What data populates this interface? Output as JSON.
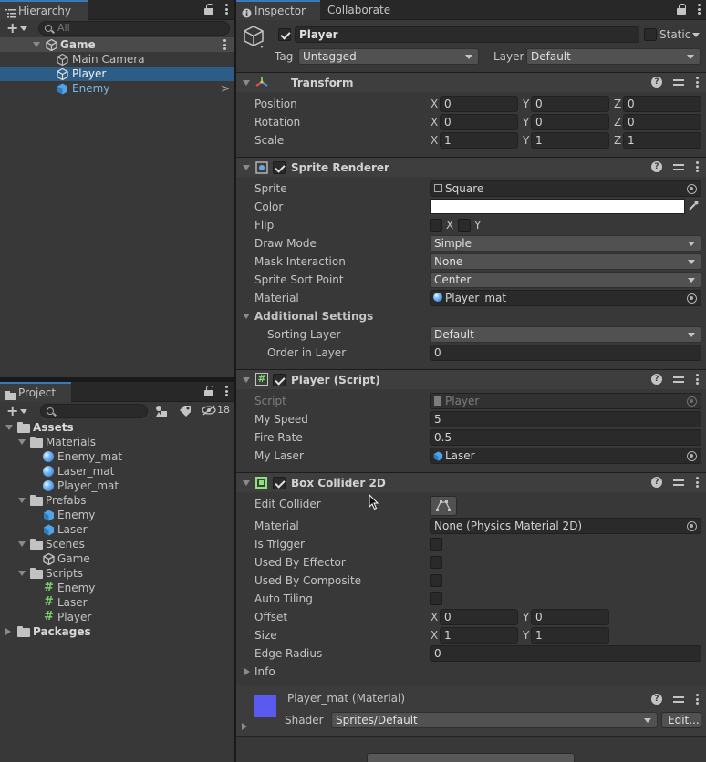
{
  "hierarchy": {
    "tab_label": "Hierarchy",
    "search_placeholder": "All",
    "scene": "Game",
    "items": [
      {
        "label": "Main Camera"
      },
      {
        "label": "Player"
      },
      {
        "label": "Enemy"
      }
    ]
  },
  "project": {
    "tab_label": "Project",
    "hidden_count": "18",
    "tree": [
      {
        "label": "Assets"
      },
      {
        "label": "Materials"
      },
      {
        "label": "Enemy_mat"
      },
      {
        "label": "Laser_mat"
      },
      {
        "label": "Player_mat"
      },
      {
        "label": "Prefabs"
      },
      {
        "label": "Enemy"
      },
      {
        "label": "Laser"
      },
      {
        "label": "Scenes"
      },
      {
        "label": "Game"
      },
      {
        "label": "Scripts"
      },
      {
        "label": "Enemy"
      },
      {
        "label": "Laser"
      },
      {
        "label": "Player"
      },
      {
        "label": "Packages"
      }
    ]
  },
  "inspector": {
    "tab_label": "Inspector",
    "tab2_label": "Collaborate",
    "object_name": "Player",
    "static_label": "Static",
    "tag_label": "Tag",
    "tag_value": "Untagged",
    "layer_label": "Layer",
    "layer_value": "Default",
    "transform": {
      "title": "Transform",
      "position_label": "Position",
      "rotation_label": "Rotation",
      "scale_label": "Scale",
      "position": {
        "x": "0",
        "y": "0",
        "z": "0"
      },
      "rotation": {
        "x": "0",
        "y": "0",
        "z": "0"
      },
      "scale": {
        "x": "1",
        "y": "1",
        "z": "1"
      }
    },
    "sprite_renderer": {
      "title": "Sprite Renderer",
      "sprite_label": "Sprite",
      "sprite_value": "Square",
      "color_label": "Color",
      "color_value": "#ffffff",
      "flip_label": "Flip",
      "flip_x": "X",
      "flip_y": "Y",
      "draw_mode_label": "Draw Mode",
      "draw_mode_value": "Simple",
      "mask_label": "Mask Interaction",
      "mask_value": "None",
      "sort_point_label": "Sprite Sort Point",
      "sort_point_value": "Center",
      "material_label": "Material",
      "material_value": "Player_mat",
      "additional_label": "Additional Settings",
      "sorting_layer_label": "Sorting Layer",
      "sorting_layer_value": "Default",
      "order_label": "Order in Layer",
      "order_value": "0"
    },
    "player_script": {
      "title": "Player (Script)",
      "script_label": "Script",
      "script_value": "Player",
      "speed_label": "My Speed",
      "speed_value": "5",
      "fire_label": "Fire Rate",
      "fire_value": "0.5",
      "laser_label": "My Laser",
      "laser_value": "Laser"
    },
    "box_collider": {
      "title": "Box Collider 2D",
      "edit_label": "Edit Collider",
      "material_label": "Material",
      "material_value": "None (Physics Material 2D)",
      "trigger_label": "Is Trigger",
      "effector_label": "Used By Effector",
      "composite_label": "Used By Composite",
      "tiling_label": "Auto Tiling",
      "offset_label": "Offset",
      "offset": {
        "x": "0",
        "y": "0"
      },
      "size_label": "Size",
      "size": {
        "x": "1",
        "y": "1"
      },
      "edge_label": "Edge Radius",
      "edge_value": "0",
      "info_label": "Info"
    },
    "material": {
      "name": "Player_mat (Material)",
      "shader_label": "Shader",
      "shader_value": "Sprites/Default",
      "edit_button": "Edit..."
    }
  },
  "colors": {
    "accent": "#3a79bb",
    "selection": "#2c5d87",
    "material_swatch": "#5a5af0"
  }
}
